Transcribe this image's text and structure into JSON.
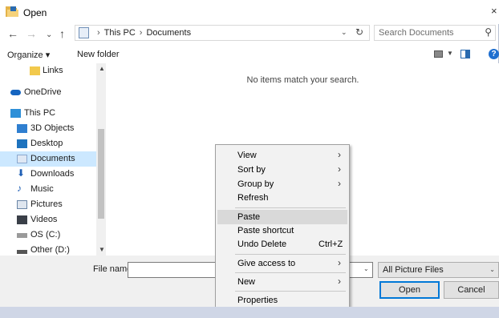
{
  "window": {
    "title": "Open",
    "close_glyph": "×"
  },
  "nav": {
    "back_glyph": "←",
    "forward_glyph": "→",
    "recent_glyph": "⌄",
    "up_glyph": "↑"
  },
  "address": {
    "crumbs": [
      "This PC",
      "Documents"
    ],
    "separator": "›",
    "dropdown_glyph": "⌄",
    "refresh_glyph": "↻"
  },
  "search": {
    "placeholder": "Search Documents",
    "icon_glyph": "⚲"
  },
  "toolbar": {
    "organize_label": "Organize ▾",
    "new_folder_label": "New folder",
    "help_glyph": "?"
  },
  "sidebar": {
    "items": [
      {
        "label": "Links",
        "icon": "folder-icon",
        "color": "#f2c94c"
      },
      {
        "label": "OneDrive",
        "icon": "cloud-icon",
        "color": "#1565c0"
      },
      {
        "label": "This PC",
        "icon": "computer-icon",
        "color": "#2d8fd8"
      },
      {
        "label": "3D Objects",
        "icon": "cube-icon",
        "color": "#2f7fd0"
      },
      {
        "label": "Desktop",
        "icon": "desktop-icon",
        "color": "#1e73be"
      },
      {
        "label": "Documents",
        "icon": "document-icon",
        "color": "#8aa8cf"
      },
      {
        "label": "Downloads",
        "icon": "download-icon",
        "color": "#1f5fb5"
      },
      {
        "label": "Music",
        "icon": "music-icon",
        "color": "#1f5fb5"
      },
      {
        "label": "Pictures",
        "icon": "pictures-icon",
        "color": "#6a85a6"
      },
      {
        "label": "Videos",
        "icon": "videos-icon",
        "color": "#3a3f48"
      },
      {
        "label": "OS (C:)",
        "icon": "drive-icon",
        "color": "#888888"
      },
      {
        "label": "Other (D:)",
        "icon": "drive-icon",
        "color": "#555555"
      }
    ],
    "selected": "Documents",
    "scroll_up_glyph": "▲",
    "scroll_down_glyph": "▼"
  },
  "content": {
    "empty_message": "No items match your search."
  },
  "footer": {
    "filename_label": "File name:",
    "filename_value": "",
    "filter_label": "All Picture Files",
    "open_label": "Open",
    "cancel_label": "Cancel",
    "dropdown_glyph": "⌄"
  },
  "context_menu": {
    "items": [
      {
        "label": "View",
        "submenu": true
      },
      {
        "label": "Sort by",
        "submenu": true
      },
      {
        "label": "Group by",
        "submenu": true
      },
      {
        "label": "Refresh",
        "submenu": false
      },
      {
        "label": "Paste",
        "submenu": false,
        "highlighted": true
      },
      {
        "label": "Paste shortcut",
        "submenu": false
      },
      {
        "label": "Undo Delete",
        "submenu": false,
        "shortcut": "Ctrl+Z"
      },
      {
        "label": "Give access to",
        "submenu": true
      },
      {
        "label": "New",
        "submenu": true
      },
      {
        "label": "Properties",
        "submenu": false
      }
    ],
    "submenu_glyph": "›"
  },
  "colors": {
    "selection": "#cce8ff",
    "menu_bg": "#f2f2f2",
    "menu_hover": "#d9d9d9",
    "accent": "#0078d7"
  }
}
